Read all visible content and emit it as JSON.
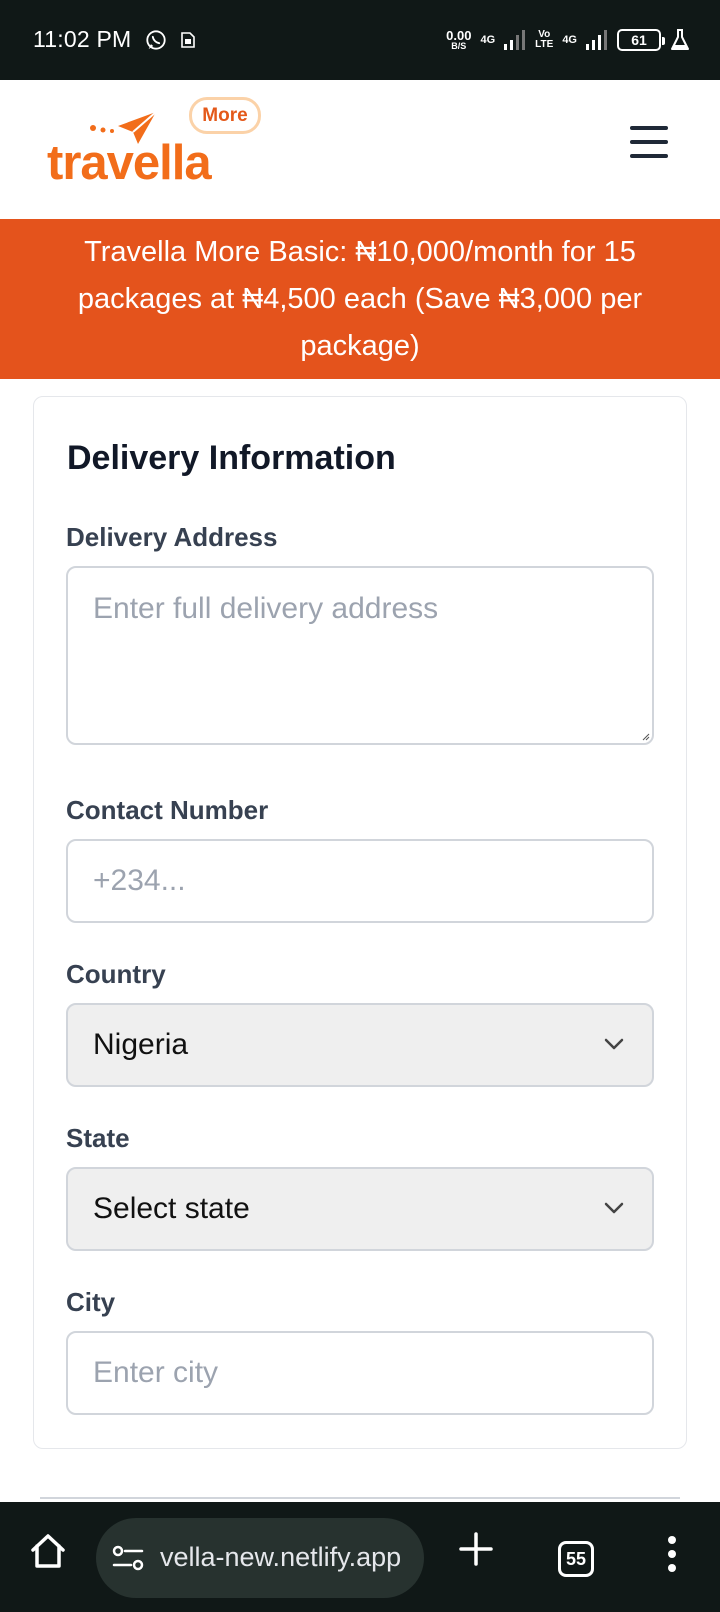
{
  "status_bar": {
    "time": "11:02 PM",
    "net_speed_value": "0.00",
    "net_speed_unit": "B/S",
    "net_type_1": "4G",
    "volte_top": "Vo",
    "volte_bottom": "LTE",
    "net_type_2": "4G",
    "battery": "61"
  },
  "header": {
    "logo_text": "travella",
    "badge": "More"
  },
  "promo": {
    "text": "Travella More Basic: ₦10,000/month for 15 packages at ₦4,500 each (Save ₦3,000 per package)"
  },
  "delivery": {
    "title": "Delivery Information",
    "address": {
      "label": "Delivery Address",
      "placeholder": "Enter full delivery address",
      "value": ""
    },
    "contact": {
      "label": "Contact Number",
      "placeholder": "+234...",
      "value": ""
    },
    "country": {
      "label": "Country",
      "selected": "Nigeria"
    },
    "state": {
      "label": "State",
      "selected": "Select state"
    },
    "city": {
      "label": "City",
      "placeholder": "Enter city",
      "value": ""
    }
  },
  "browser": {
    "url": "vella-new.netlify.app",
    "tab_count": "55"
  },
  "colors": {
    "brand_orange": "#f26d1a",
    "banner": "#e4531c",
    "status_bar": "#101817"
  }
}
